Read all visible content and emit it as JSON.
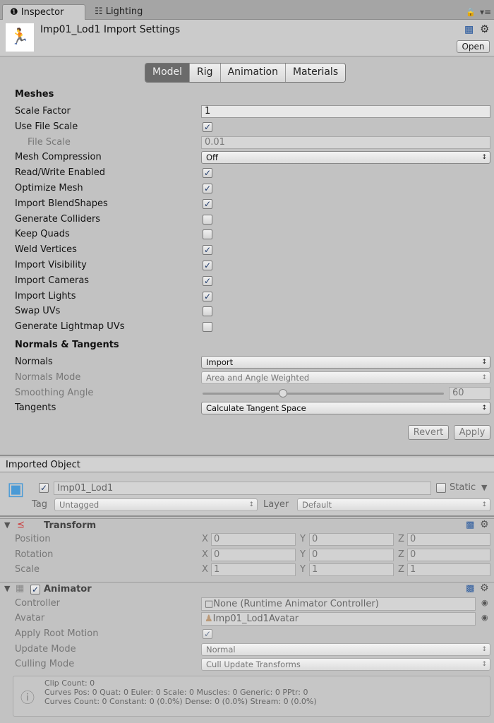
{
  "tabs": [
    {
      "label": "Inspector",
      "icon": "info-icon"
    },
    {
      "label": "Lighting",
      "icon": "lighting-icon"
    }
  ],
  "header": {
    "title": "Imp01_Lod1 Import Settings",
    "open_label": "Open"
  },
  "mode_tabs": [
    "Model",
    "Rig",
    "Animation",
    "Materials"
  ],
  "active_mode": "Model",
  "meshes": {
    "title": "Meshes",
    "rows": [
      {
        "label": "Scale Factor",
        "type": "text",
        "value": "1"
      },
      {
        "label": "Use File Scale",
        "type": "check",
        "checked": true
      },
      {
        "label": "File Scale",
        "type": "text",
        "value": "0.01",
        "disabled": true,
        "indent": true
      },
      {
        "label": "Mesh Compression",
        "type": "select",
        "value": "Off"
      },
      {
        "label": "Read/Write Enabled",
        "type": "check",
        "checked": true
      },
      {
        "label": "Optimize Mesh",
        "type": "check",
        "checked": true
      },
      {
        "label": "Import BlendShapes",
        "type": "check",
        "checked": true
      },
      {
        "label": "Generate Colliders",
        "type": "check",
        "checked": false
      },
      {
        "label": "Keep Quads",
        "type": "check",
        "checked": false
      },
      {
        "label": "Weld Vertices",
        "type": "check",
        "checked": true
      },
      {
        "label": "Import Visibility",
        "type": "check",
        "checked": true
      },
      {
        "label": "Import Cameras",
        "type": "check",
        "checked": true
      },
      {
        "label": "Import Lights",
        "type": "check",
        "checked": true
      },
      {
        "label": "Swap UVs",
        "type": "check",
        "checked": false
      },
      {
        "label": "Generate Lightmap UVs",
        "type": "check",
        "checked": false
      }
    ]
  },
  "normals": {
    "title": "Normals & Tangents",
    "rows": [
      {
        "label": "Normals",
        "type": "select",
        "value": "Import"
      },
      {
        "label": "Normals Mode",
        "type": "select",
        "value": "Area and Angle Weighted",
        "disabled": true
      },
      {
        "label": "Smoothing Angle",
        "type": "slider",
        "value": "60",
        "min": 0,
        "max": 180,
        "disabled": true
      },
      {
        "label": "Tangents",
        "type": "select",
        "value": "Calculate Tangent Space"
      }
    ]
  },
  "actions": {
    "revert": "Revert",
    "apply": "Apply"
  },
  "imported": {
    "title": "Imported Object",
    "name": "Imp01_Lod1",
    "active": true,
    "static_label": "Static",
    "static": false,
    "tag_label": "Tag",
    "tag": "Untagged",
    "layer_label": "Layer",
    "layer": "Default"
  },
  "transform": {
    "title": "Transform",
    "rows": [
      {
        "label": "Position",
        "x": "0",
        "y": "0",
        "z": "0"
      },
      {
        "label": "Rotation",
        "x": "0",
        "y": "0",
        "z": "0"
      },
      {
        "label": "Scale",
        "x": "1",
        "y": "1",
        "z": "1"
      }
    ],
    "axes": [
      "X",
      "Y",
      "Z"
    ]
  },
  "animator": {
    "title": "Animator",
    "enabled": true,
    "controller_label": "Controller",
    "controller": "None (Runtime Animator Controller)",
    "avatar_label": "Avatar",
    "avatar": "Imp01_Lod1Avatar",
    "root_motion_label": "Apply Root Motion",
    "root_motion": true,
    "update_label": "Update Mode",
    "update": "Normal",
    "culling_label": "Culling Mode",
    "culling": "Cull Update Transforms",
    "info": [
      "Clip Count: 0",
      "Curves Pos: 0 Quat: 0 Euler: 0 Scale: 0 Muscles: 0 Generic: 0 PPtr: 0",
      "Curves Count: 0 Constant: 0 (0.0%) Dense: 0 (0.0%) Stream: 0 (0.0%)"
    ]
  }
}
